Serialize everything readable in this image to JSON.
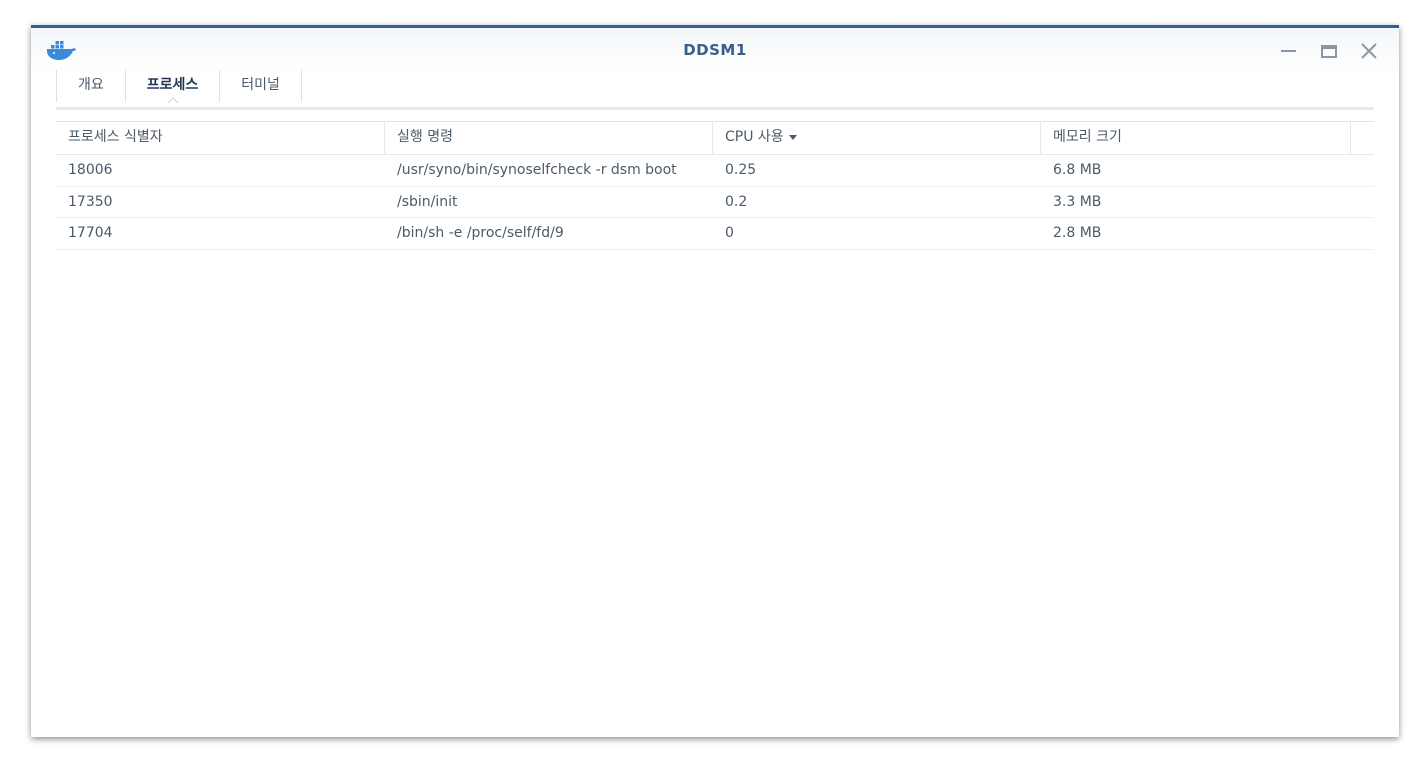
{
  "window": {
    "title": "DDSM1",
    "app_icon": "docker-whale-icon",
    "controls": [
      "minimize-icon",
      "maximize-icon",
      "close-icon"
    ]
  },
  "tabs": [
    {
      "label": "개요",
      "active": false
    },
    {
      "label": "프로세스",
      "active": true
    },
    {
      "label": "터미널",
      "active": false
    }
  ],
  "table": {
    "headers": {
      "pid": "프로세스 식별자",
      "command": "실행 명령",
      "cpu": "CPU 사용",
      "memory": "메모리 크기"
    },
    "sorted_by": "cpu",
    "sort_direction": "desc",
    "rows": [
      {
        "pid": "18006",
        "command": "/usr/syno/bin/synoselfcheck -r dsm boot",
        "cpu": "0.25",
        "memory": "6.8 MB"
      },
      {
        "pid": "17350",
        "command": "/sbin/init",
        "cpu": "0.2",
        "memory": "3.3 MB"
      },
      {
        "pid": "17704",
        "command": "/bin/sh -e /proc/self/fd/9",
        "cpu": "0",
        "memory": "2.8 MB"
      }
    ]
  },
  "colors": {
    "accent": "#2f5f9d",
    "title_text": "#3a5e8c",
    "body_text": "#4b5a6a",
    "icon_blue": "#3b8ad8"
  }
}
